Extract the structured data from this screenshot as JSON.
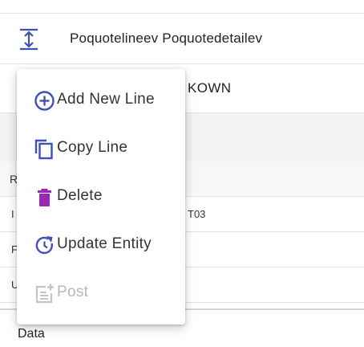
{
  "header": {
    "title": "Poquotelineev Poquotedetailev",
    "icon": "expand-vertical-icon",
    "accent_color": "#3f51b5"
  },
  "subrow": {
    "value": "KOWN"
  },
  "table": {
    "header_label": "R",
    "rows": [
      {
        "col_a": "I",
        "col_b": "T03"
      },
      {
        "col_a": "F",
        "col_b": ""
      },
      {
        "col_a": "U",
        "col_b": ""
      }
    ]
  },
  "footer": {
    "label": "Data"
  },
  "menu": {
    "items": [
      {
        "label": "Add New Line",
        "icon": "add-circle-icon",
        "color": "#3f51b5",
        "enabled": true
      },
      {
        "label": "Copy Line",
        "icon": "copy-icon",
        "color": "#3f51b5",
        "enabled": true
      },
      {
        "label": "Delete",
        "icon": "trash-icon",
        "color": "#9c27b0",
        "enabled": true
      },
      {
        "label": "Update Entity",
        "icon": "refresh-clock-icon",
        "color": "#3f51b5",
        "enabled": true
      },
      {
        "label": "Post",
        "icon": "post-add-icon",
        "color": "#c4c4c4",
        "enabled": false
      }
    ]
  }
}
